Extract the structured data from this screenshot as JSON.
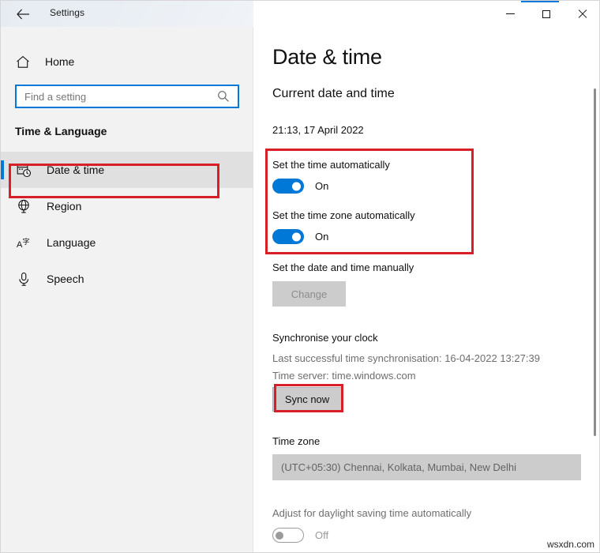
{
  "window": {
    "title": "Settings",
    "back_icon": "back-arrow-icon",
    "minimize_label": "Minimize",
    "maximize_label": "Maximize",
    "close_label": "Close"
  },
  "sidebar": {
    "home_label": "Home",
    "home_icon": "home-icon",
    "search": {
      "placeholder": "Find a setting",
      "value": "",
      "icon": "search-icon"
    },
    "section_title": "Time & Language",
    "items": [
      {
        "label": "Date & time",
        "icon": "calendar-clock-icon",
        "selected": true
      },
      {
        "label": "Region",
        "icon": "globe-icon",
        "selected": false
      },
      {
        "label": "Language",
        "icon": "language-icon",
        "selected": false
      },
      {
        "label": "Speech",
        "icon": "microphone-icon",
        "selected": false
      }
    ]
  },
  "main": {
    "page_title": "Date & time",
    "current_section_heading": "Current date and time",
    "current_datetime": "21:13, 17 April 2022",
    "set_time_auto": {
      "label": "Set the time automatically",
      "state": "On"
    },
    "set_timezone_auto": {
      "label": "Set the time zone automatically",
      "state": "On"
    },
    "manual": {
      "label": "Set the date and time manually",
      "button_label": "Change",
      "button_enabled": false
    },
    "sync": {
      "heading": "Synchronise your clock",
      "last_sync": "Last successful time synchronisation: 16-04-2022 13:27:39",
      "time_server": "Time server: time.windows.com",
      "button_label": "Sync now"
    },
    "timezone": {
      "heading": "Time zone",
      "selected": "(UTC+05:30) Chennai, Kolkata, Mumbai, New Delhi"
    },
    "dst": {
      "label": "Adjust for daylight saving time automatically",
      "state": "Off"
    }
  },
  "annotations": {
    "accent_color": "#0078d7",
    "highlight_color": "#d81f26",
    "watermark": "wsxdn.com"
  }
}
